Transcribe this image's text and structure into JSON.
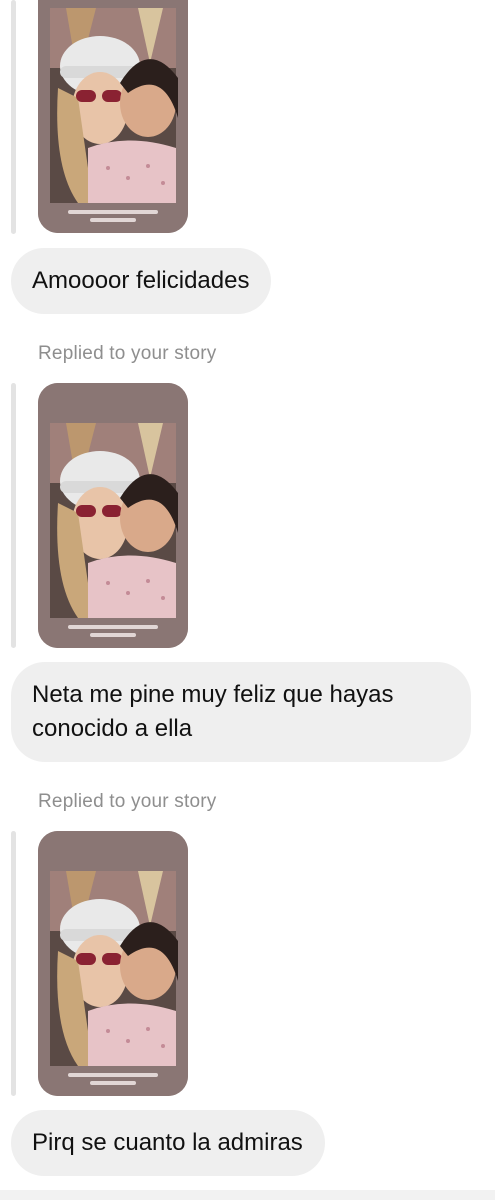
{
  "thread": {
    "reply_label": "Replied to your story",
    "messages": [
      {
        "text": "Amoooor felicidades"
      },
      {
        "text": "Neta me pine muy feliz que hayas conocido a ella"
      },
      {
        "text": "Pirq se cuanto la admiras"
      }
    ]
  },
  "colors": {
    "bubble_bg": "#efefef",
    "reply_label": "#8e8e8e",
    "story_frame": "#8a7674"
  }
}
